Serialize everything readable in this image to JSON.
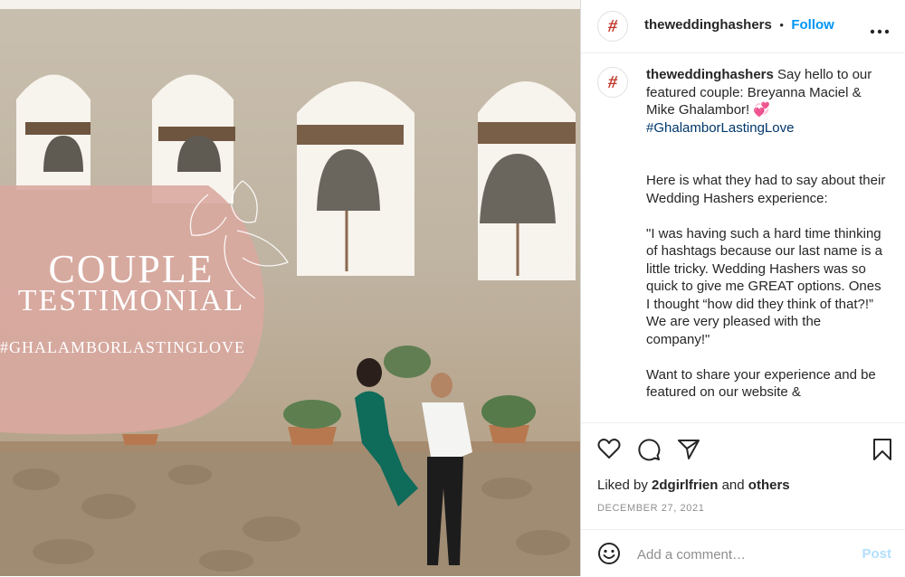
{
  "post": {
    "image_alt": "Couple sitting on a stone mission wall beneath bell arches",
    "overlay": {
      "title_line1": "COUPLE",
      "title_line2": "TESTIMONIAL",
      "hashtag": "#GHALAMBORLASTINGLOVE"
    }
  },
  "header": {
    "username": "theweddinghashers",
    "separator": "•",
    "follow_label": "Follow",
    "more_icon": "more-horizontal-icon",
    "avatar_glyph": "#"
  },
  "caption": {
    "username": "theweddinghashers",
    "intro": "Say hello to our featured couple: Breyanna Maciel & Mike Ghalambor! 💞",
    "hashtag": "#GhalamborLastingLove",
    "para1": "Here is what they had to say about their Wedding Hashers experience:",
    "para2": "\"I was having such a hard time thinking of hashtags because our last name is a little tricky. Wedding Hashers was so quick to give me GREAT options. Ones I thought “how did they think of that?!” We are very pleased with the company!\"",
    "para3": "Want to share your experience and be featured on our website &"
  },
  "actions": {
    "icons": [
      "heart-icon",
      "comment-icon",
      "share-icon",
      "bookmark-icon"
    ],
    "liked_by_prefix": "Liked by",
    "liked_by_user": "2dgirlfrien",
    "liked_by_and": "and",
    "liked_by_others": "others",
    "date": "DECEMBER 27, 2021"
  },
  "comment": {
    "placeholder": "Add a comment…",
    "post_label": "Post",
    "emoji_icon": "emoji-icon"
  },
  "colors": {
    "follow": "#0095f6",
    "hashtag": "#00376b",
    "post_disabled": "#b2dffc",
    "overlay_pink": "#d9a9a0"
  }
}
